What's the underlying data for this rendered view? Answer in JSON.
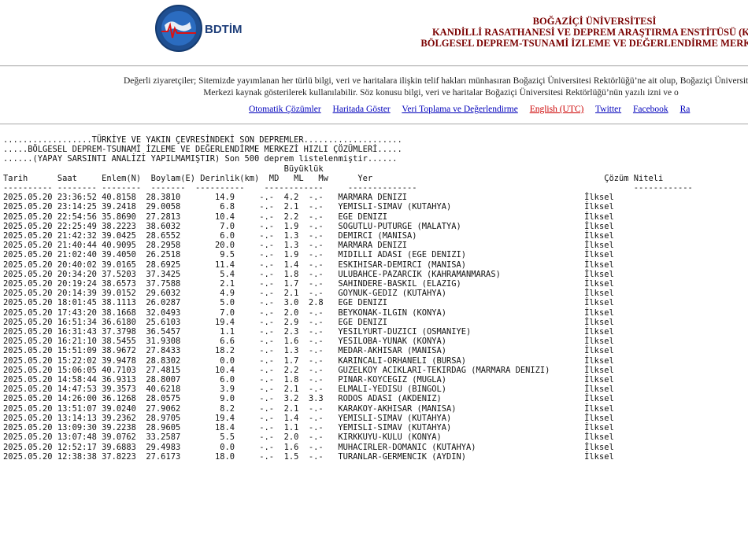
{
  "header": {
    "logo_text": "BDTİM",
    "line1": "BOĞAZİÇİ ÜNİVERSİTESİ",
    "line2": "KANDİLLİ RASATHANESİ VE DEPREM ARAŞTIRMA ENSTİTÜSÜ (KR",
    "line3": "BÖLGESEL DEPREM-TSUNAMİ İZLEME VE DEĞERLENDİRME MERKEZİ"
  },
  "notice": {
    "line1": "Değerli ziyaretçiler; Sitemizde yayımlanan her türlü bilgi, veri ve haritalara ilişkin telif hakları münhasıran Boğaziçi Üniversitesi Rektörlüğü’ne ait olup, Boğaziçi Üniversitesi",
    "line2": "Merkezi kaynak gösterilerek kullanılabilir. Söz konusu bilgi, veri ve haritalar Boğaziçi Üniversitesi Rektörlüğü’nün yazılı izni ve o"
  },
  "links": [
    "Otomatik Çözümler",
    "Haritada Göster",
    "Veri Toplama ve Değerlendirme",
    "English (UTC)",
    "Twitter",
    "Facebook",
    "Ra"
  ],
  "list": {
    "title1": "..................TÜRKİYE VE YAKIN ÇEVRESİNDEKİ SON DEPREMLER....................",
    "title2": ".....BÖLGESEL DEPREM-TSUNAMİ İZLEME VE DEĞERLENDİRME MERKEZİ HIZLI ÇÖZÜMLERİ.....",
    "title3": "......(YAPAY SARSINTI ANALİZİ YAPILMAMIŞTIR) Son 500 deprem listelenmiştir......",
    "buyukluk": "Büyüklük",
    "columns": [
      "Tarih",
      "Saat",
      "Enlem(N)",
      "Boylam(E)",
      "Derinlik(km)",
      "MD",
      "ML",
      "Mw",
      "Yer",
      "Çözüm Niteli"
    ],
    "rows": [
      [
        "2025.05.20",
        "23:36:52",
        "40.8158",
        "28.3810",
        "14.9",
        "-.-",
        "4.2",
        "-.-",
        "MARMARA DENIZI",
        "İlksel"
      ],
      [
        "2025.05.20",
        "23:14:25",
        "39.2418",
        "29.0058",
        "6.8",
        "-.-",
        "2.1",
        "-.-",
        "YEMISLI-SIMAV (KUTAHYA)",
        "İlksel"
      ],
      [
        "2025.05.20",
        "22:54:56",
        "35.8690",
        "27.2813",
        "10.4",
        "-.-",
        "2.2",
        "-.-",
        "EGE DENIZI",
        "İlksel"
      ],
      [
        "2025.05.20",
        "22:25:49",
        "38.2223",
        "38.6032",
        "7.0",
        "-.-",
        "1.9",
        "-.-",
        "SOGUTLU-PUTURGE (MALATYA)",
        "İlksel"
      ],
      [
        "2025.05.20",
        "21:42:32",
        "39.0425",
        "28.6552",
        "6.0",
        "-.-",
        "1.3",
        "-.-",
        "DEMIRCI (MANISA)",
        "İlksel"
      ],
      [
        "2025.05.20",
        "21:40:44",
        "40.9095",
        "28.2958",
        "20.0",
        "-.-",
        "1.3",
        "-.-",
        "MARMARA DENIZI",
        "İlksel"
      ],
      [
        "2025.05.20",
        "21:02:40",
        "39.4050",
        "26.2518",
        "9.5",
        "-.-",
        "1.9",
        "-.-",
        "MIDILLI ADASI (EGE DENIZI)",
        "İlksel"
      ],
      [
        "2025.05.20",
        "20:40:02",
        "39.0165",
        "28.6925",
        "11.4",
        "-.-",
        "1.4",
        "-.-",
        "ESKIHISAR-DEMIRCI (MANISA)",
        "İlksel"
      ],
      [
        "2025.05.20",
        "20:34:20",
        "37.5203",
        "37.3425",
        "5.4",
        "-.-",
        "1.8",
        "-.-",
        "ULUBAHCE-PAZARCIK (KAHRAMANMARAS)",
        "İlksel"
      ],
      [
        "2025.05.20",
        "20:19:24",
        "38.6573",
        "37.7588",
        "2.1",
        "-.-",
        "1.7",
        "-.-",
        "SAHINDERE-BASKIL (ELAZIG)",
        "İlksel"
      ],
      [
        "2025.05.20",
        "20:14:39",
        "39.0152",
        "29.6032",
        "4.9",
        "-.-",
        "2.1",
        "-.-",
        "GOYNUK-GEDIZ (KUTAHYA)",
        "İlksel"
      ],
      [
        "2025.05.20",
        "18:01:45",
        "38.1113",
        "26.0287",
        "5.0",
        "-.-",
        "3.0",
        "2.8",
        "EGE DENIZI",
        "İlksel"
      ],
      [
        "2025.05.20",
        "17:43:20",
        "38.1668",
        "32.0493",
        "7.0",
        "-.-",
        "2.0",
        "-.-",
        "BEYKONAK-ILGIN (KONYA)",
        "İlksel"
      ],
      [
        "2025.05.20",
        "16:51:34",
        "36.6180",
        "25.6103",
        "19.4",
        "-.-",
        "2.9",
        "-.-",
        "EGE DENIZI",
        "İlksel"
      ],
      [
        "2025.05.20",
        "16:31:43",
        "37.3798",
        "36.5457",
        "1.1",
        "-.-",
        "2.3",
        "-.-",
        "YESILYURT-DUZICI (OSMANIYE)",
        "İlksel"
      ],
      [
        "2025.05.20",
        "16:21:10",
        "38.5455",
        "31.9308",
        "6.6",
        "-.-",
        "1.6",
        "-.-",
        "YESILOBA-YUNAK (KONYA)",
        "İlksel"
      ],
      [
        "2025.05.20",
        "15:51:09",
        "38.9672",
        "27.8433",
        "18.2",
        "-.-",
        "1.3",
        "-.-",
        "MEDAR-AKHISAR (MANISA)",
        "İlksel"
      ],
      [
        "2025.05.20",
        "15:22:02",
        "39.9478",
        "28.8302",
        "0.0",
        "-.-",
        "1.7",
        "-.-",
        "KARINCALI-ORHANELI (BURSA)",
        "İlksel"
      ],
      [
        "2025.05.20",
        "15:06:05",
        "40.7103",
        "27.4815",
        "10.4",
        "-.-",
        "2.2",
        "-.-",
        "GUZELKOY ACIKLARI-TEKIRDAG (MARMARA DENIZI)",
        "İlksel"
      ],
      [
        "2025.05.20",
        "14:58:44",
        "36.9313",
        "28.8007",
        "6.0",
        "-.-",
        "1.8",
        "-.-",
        "PINAR-KOYCEGIZ (MUGLA)",
        "İlksel"
      ],
      [
        "2025.05.20",
        "14:47:53",
        "39.3573",
        "40.6218",
        "3.9",
        "-.-",
        "2.1",
        "-.-",
        "ELMALI-YEDISU (BINGOL)",
        "İlksel"
      ],
      [
        "2025.05.20",
        "14:26:00",
        "36.1268",
        "28.0575",
        "9.0",
        "-.-",
        "3.2",
        "3.3",
        "RODOS ADASI (AKDENIZ)",
        "İlksel"
      ],
      [
        "2025.05.20",
        "13:51:07",
        "39.0240",
        "27.9062",
        "8.2",
        "-.-",
        "2.1",
        "-.-",
        "KARAKOY-AKHISAR (MANISA)",
        "İlksel"
      ],
      [
        "2025.05.20",
        "13:14:13",
        "39.2362",
        "28.9705",
        "19.4",
        "-.-",
        "1.4",
        "-.-",
        "YEMISLI-SIMAV (KUTAHYA)",
        "İlksel"
      ],
      [
        "2025.05.20",
        "13:09:30",
        "39.2238",
        "28.9605",
        "18.4",
        "-.-",
        "1.1",
        "-.-",
        "YEMISLI-SIMAV (KUTAHYA)",
        "İlksel"
      ],
      [
        "2025.05.20",
        "13:07:48",
        "39.0762",
        "33.2587",
        "5.5",
        "-.-",
        "2.0",
        "-.-",
        "KIRKKUYU-KULU (KONYA)",
        "İlksel"
      ],
      [
        "2025.05.20",
        "12:52:17",
        "39.6883",
        "29.4983",
        "0.0",
        "-.-",
        "1.6",
        "-.-",
        "MUHACIRLER-DOMANIC (KUTAHYA)",
        "İlksel"
      ],
      [
        "2025.05.20",
        "12:38:38",
        "37.8223",
        "27.6173",
        "18.0",
        "-.-",
        "1.5",
        "-.-",
        "TURANLAR-GERMENCIK (AYDIN)",
        "İlksel"
      ]
    ]
  }
}
